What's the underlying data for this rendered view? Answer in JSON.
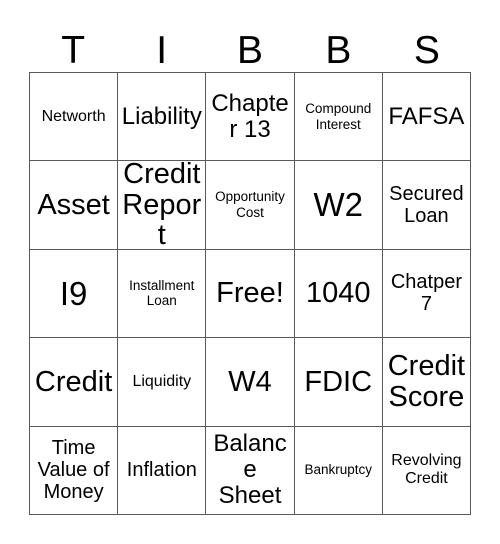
{
  "card": {
    "header_letters": [
      "T",
      "I",
      "B",
      "B",
      "S"
    ],
    "rows": [
      [
        {
          "text": "Networth",
          "size": "fs-s"
        },
        {
          "text": "Liability",
          "size": "fs-l"
        },
        {
          "text": "Chapter 13",
          "size": "fs-l"
        },
        {
          "text": "Compound Interest",
          "size": "fs-xs"
        },
        {
          "text": "FAFSA",
          "size": "fs-l"
        }
      ],
      [
        {
          "text": "Asset",
          "size": "fs-xl"
        },
        {
          "text": "Credit Report",
          "size": "fs-xl"
        },
        {
          "text": "Opportunity Cost",
          "size": "fs-xs"
        },
        {
          "text": "W2",
          "size": "fs-xxl"
        },
        {
          "text": "Secured Loan",
          "size": "fs-m"
        }
      ],
      [
        {
          "text": "I9",
          "size": "fs-xxl"
        },
        {
          "text": "Installment Loan",
          "size": "fs-xs"
        },
        {
          "text": "Free!",
          "size": "fs-xl"
        },
        {
          "text": "1040",
          "size": "fs-xl"
        },
        {
          "text": "Chatper 7",
          "size": "fs-m"
        }
      ],
      [
        {
          "text": "Credit",
          "size": "fs-xl"
        },
        {
          "text": "Liquidity",
          "size": "fs-s"
        },
        {
          "text": "W4",
          "size": "fs-xl"
        },
        {
          "text": "FDIC",
          "size": "fs-xl"
        },
        {
          "text": "Credit Score",
          "size": "fs-xl"
        }
      ],
      [
        {
          "text": "Time Value of Money",
          "size": "fs-m"
        },
        {
          "text": "Inflation",
          "size": "fs-m"
        },
        {
          "text": "Balance Sheet",
          "size": "fs-l"
        },
        {
          "text": "Bankruptcy",
          "size": "fs-xs"
        },
        {
          "text": "Revolving Credit",
          "size": "fs-s"
        }
      ]
    ],
    "colors": {
      "background": "#ffffff",
      "text": "#000000",
      "border": "#5a5a5a"
    }
  }
}
